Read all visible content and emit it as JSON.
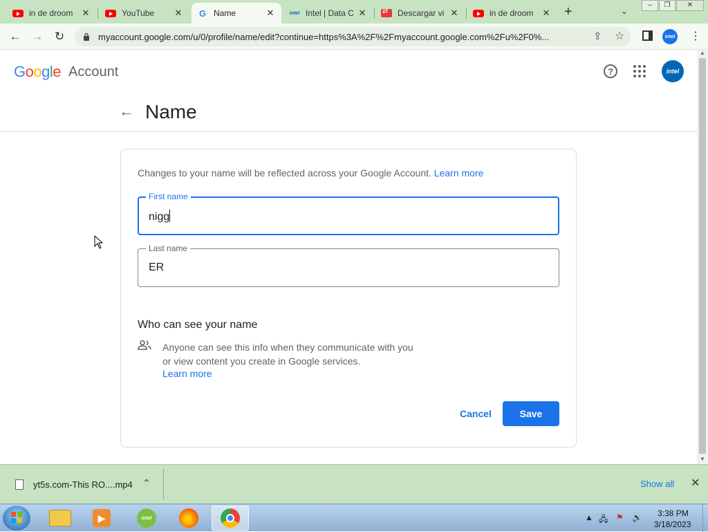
{
  "browser": {
    "tabs": [
      {
        "label": "in de droom",
        "icon": "youtube-icon"
      },
      {
        "label": "YouTube",
        "icon": "youtube-icon"
      },
      {
        "label": "Name",
        "icon": "google-icon",
        "active": true
      },
      {
        "label": "Intel | Data C",
        "icon": "intel-icon"
      },
      {
        "label": "Descargar vi",
        "icon": "download-site-icon"
      },
      {
        "label": "in de droom",
        "icon": "youtube-icon"
      }
    ],
    "url": "myaccount.google.com/u/0/profile/name/edit?continue=https%3A%2F%2Fmyaccount.google.com%2Fu%2F0%...",
    "profile_label": "intel"
  },
  "header": {
    "logo_letters": [
      "G",
      "o",
      "o",
      "g",
      "l",
      "e"
    ],
    "logo_colors": [
      "#4285f4",
      "#ea4335",
      "#fbbc05",
      "#4285f4",
      "#34a853",
      "#ea4335"
    ],
    "product": "Account",
    "avatar_label": "intel"
  },
  "page": {
    "title": "Name",
    "intro_text": "Changes to your name will be reflected across your Google Account.",
    "intro_link": "Learn more",
    "first_name_label": "First name",
    "first_name_value": "nigg",
    "last_name_label": "Last name",
    "last_name_value": "ER",
    "visibility_title": "Who can see your name",
    "visibility_text": "Anyone can see this info when they communicate with you or view content you create in Google services.",
    "visibility_link": "Learn more",
    "cancel_label": "Cancel",
    "save_label": "Save"
  },
  "download_bar": {
    "file_name": "yt5s.com-This RO....mp4",
    "show_all": "Show all"
  },
  "taskbar": {
    "apps": [
      "file-explorer-icon",
      "media-player-icon",
      "intel-graphics-icon",
      "firefox-icon",
      "chrome-icon"
    ],
    "time": "3:38 PM",
    "date": "3/18/2023"
  },
  "colors": {
    "accent": "#1a73e8",
    "chrome_frame": "#c7e3c2",
    "toolbar": "#f4faf2"
  }
}
